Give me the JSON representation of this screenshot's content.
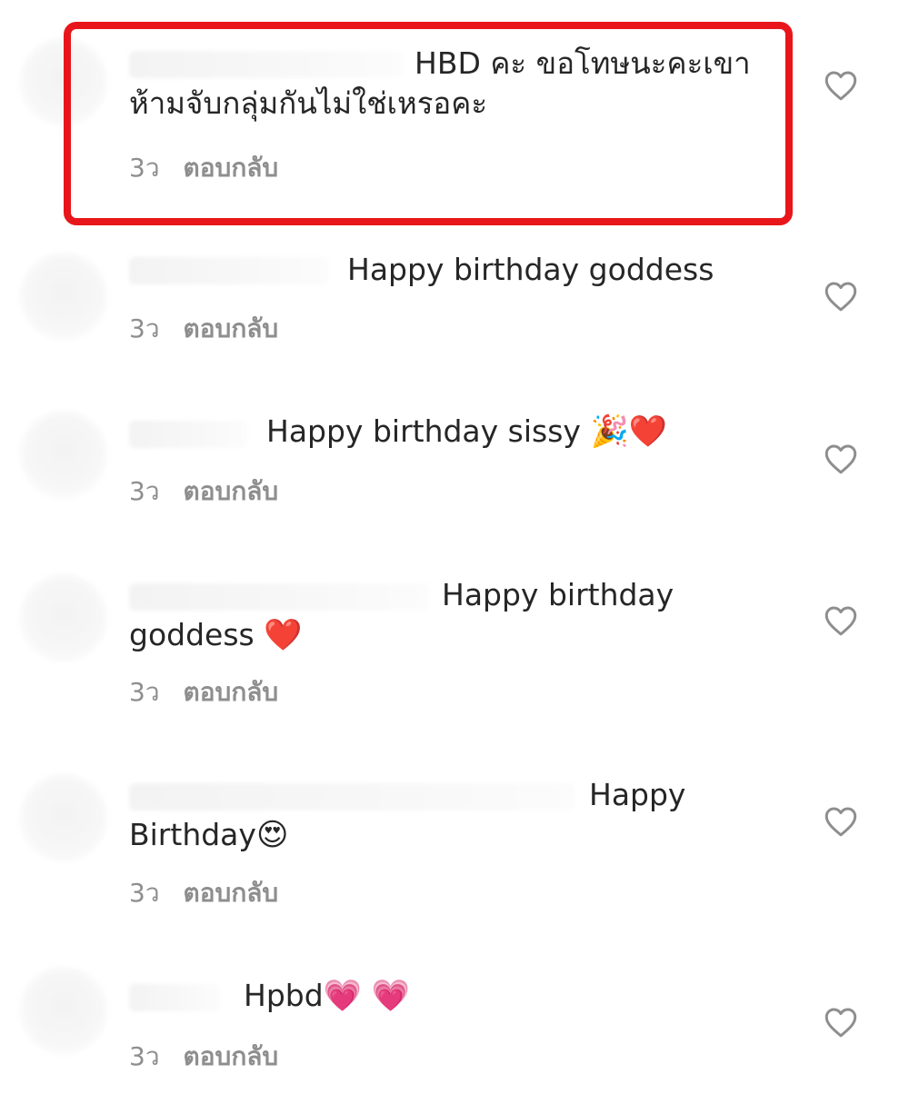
{
  "comments": [
    {
      "text_line1": "HBD คะ ขอโทษนะคะเขา",
      "text_line2": "ห้ามจับกลุ่มกันไม่ใช่เหรอคะ",
      "time": "3ว",
      "reply": "ตอบกลับ",
      "highlighted": true
    },
    {
      "text_line1": "Happy birthday goddess",
      "time": "3ว",
      "reply": "ตอบกลับ"
    },
    {
      "text_line1": "Happy birthday sissy",
      "emoji": "🎉❤️",
      "time": "3ว",
      "reply": "ตอบกลับ"
    },
    {
      "text_line1": "Happy birthday",
      "text_line2": "goddess",
      "emoji": "❤️",
      "time": "3ว",
      "reply": "ตอบกลับ"
    },
    {
      "text_line1": "Happy",
      "text_line2": "Birthday",
      "emoji": "😍",
      "time": "3ว",
      "reply": "ตอบกลับ"
    },
    {
      "text_line1": "Hpbd",
      "emoji": "💗 💗",
      "time": "3ว",
      "reply": "ตอบกลับ"
    }
  ],
  "icons": {
    "like": "heart-outline-icon"
  },
  "colors": {
    "text": "#262626",
    "meta": "#8e8e8e",
    "highlight_border": "#e8161b",
    "heart_outline": "#8e8e8e"
  }
}
